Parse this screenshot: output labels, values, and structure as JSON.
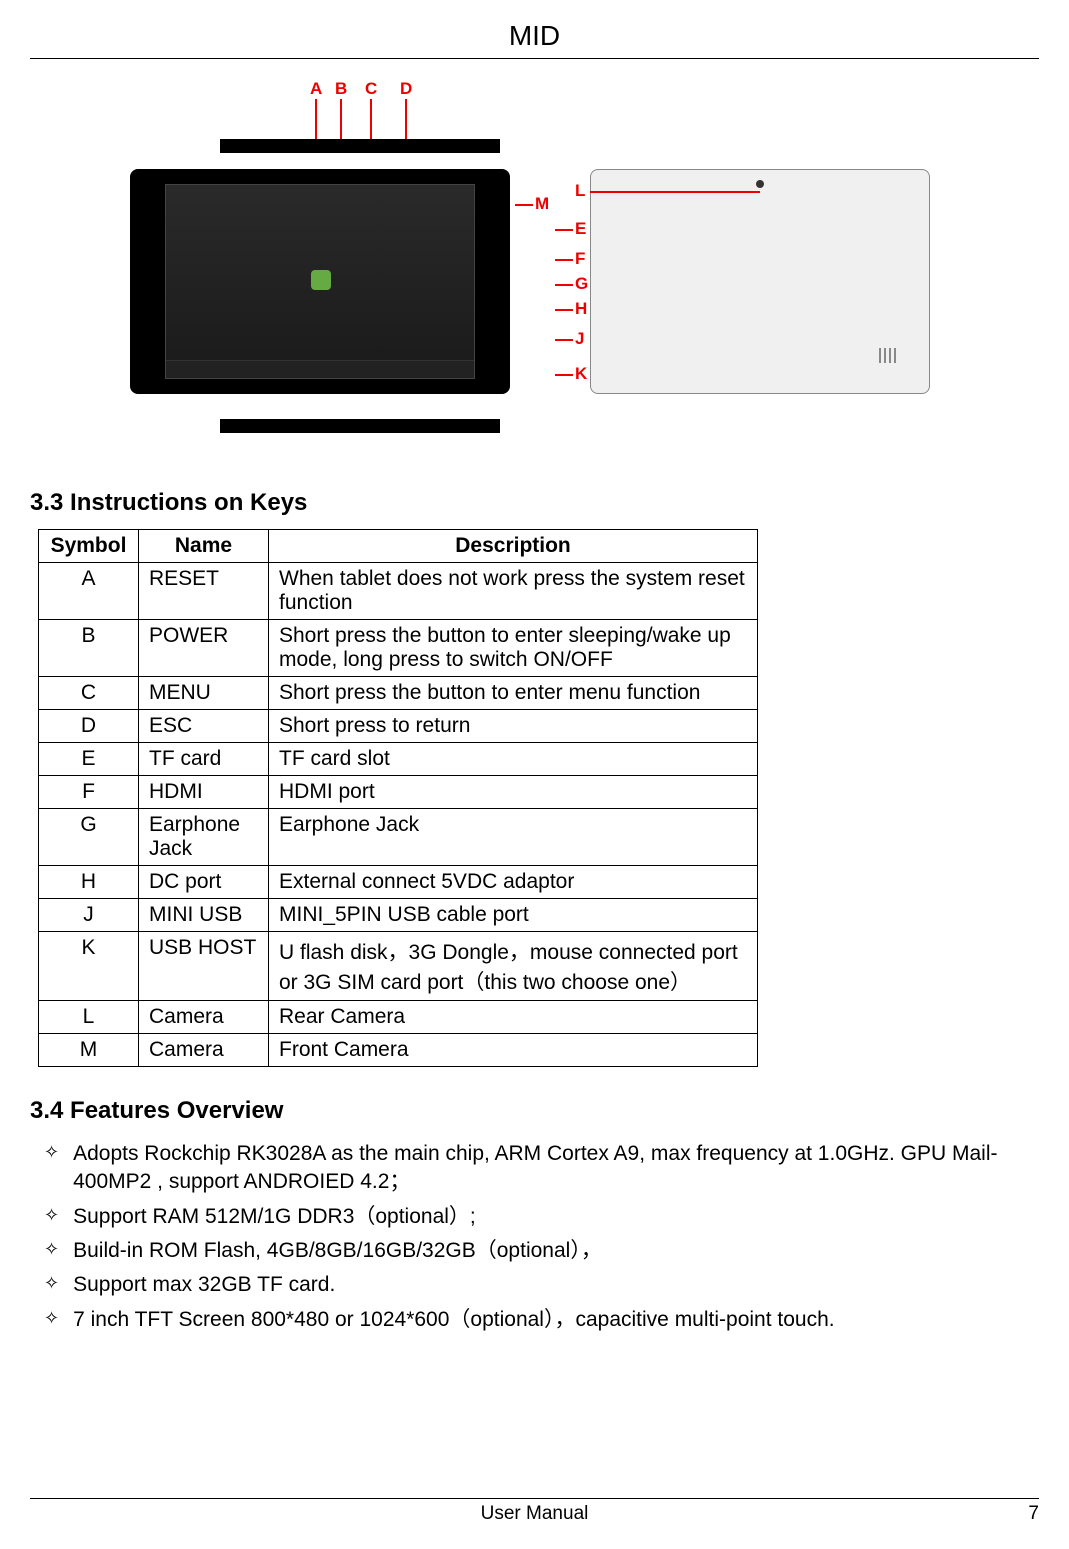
{
  "header": {
    "title": "MID"
  },
  "diagram": {
    "top_labels": [
      "A",
      "B",
      "C",
      "D"
    ],
    "side_labels": [
      "M",
      "L",
      "E",
      "F",
      "G",
      "H",
      "J",
      "K"
    ]
  },
  "section33": {
    "title": "3.3 Instructions on Keys",
    "headers": {
      "symbol": "Symbol",
      "name": "Name",
      "description": "Description"
    },
    "rows": [
      {
        "symbol": "A",
        "name": "RESET",
        "description": "When tablet does not work press the system reset function"
      },
      {
        "symbol": "B",
        "name": "POWER",
        "description": "Short press the button to enter sleeping/wake up mode, long press to switch ON/OFF"
      },
      {
        "symbol": "C",
        "name": "MENU",
        "description": "Short press the button to enter menu function"
      },
      {
        "symbol": "D",
        "name": "ESC",
        "description": "Short press to return"
      },
      {
        "symbol": "E",
        "name": "TF card",
        "description": "TF card slot"
      },
      {
        "symbol": "F",
        "name": "HDMI",
        "description": "HDMI port"
      },
      {
        "symbol": "G",
        "name": "Earphone Jack",
        "description": "Earphone Jack"
      },
      {
        "symbol": "H",
        "name": "DC port",
        "description": "External connect 5VDC adaptor"
      },
      {
        "symbol": "J",
        "name": "MINI USB",
        "description": "MINI_5PIN USB cable port"
      },
      {
        "symbol": "K",
        "name": "USB HOST",
        "description": "U flash disk，3G Dongle，mouse connected port or 3G SIM card port（this two choose one）"
      },
      {
        "symbol": "L",
        "name": "Camera",
        "description": "Rear Camera"
      },
      {
        "symbol": "M",
        "name": "Camera",
        "description": "Front Camera"
      }
    ]
  },
  "section34": {
    "title": "3.4 Features Overview",
    "items": [
      "Adopts Rockchip RK3028A as the main chip, ARM Cortex A9, max frequency at 1.0GHz. GPU Mail-400MP2 , support ANDROIED 4.2；",
      "Support RAM   512M/1G   DDR3（optional）;",
      "Build-in ROM   Flash,   4GB/8GB/16GB/32GB（optional），",
      "Support max 32GB TF card.",
      "7 inch TFT Screen   800*480 or 1024*600（optional），capacitive multi-point touch."
    ]
  },
  "footer": {
    "text": "User Manual",
    "page": "7"
  }
}
